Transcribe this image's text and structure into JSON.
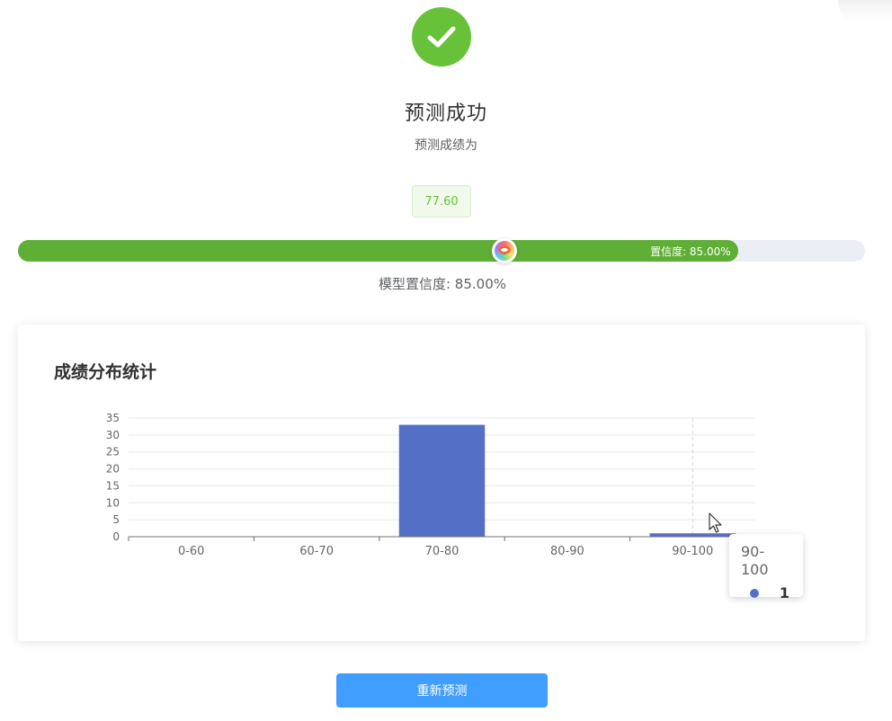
{
  "result": {
    "title": "预测成功",
    "subtitle": "预测成绩为",
    "score": "77.60",
    "success_color": "#67c23a",
    "icon": "check-icon"
  },
  "confidence": {
    "progress_text": "置信度: 85.00%",
    "label": "模型置信度: 85.00%",
    "percent": 85,
    "fill_color": "#5fae35",
    "track_color": "#ebeef5"
  },
  "distribution": {
    "title": "成绩分布统计",
    "chart_data": {
      "type": "bar",
      "categories": [
        "0-60",
        "60-70",
        "70-80",
        "80-90",
        "90-100"
      ],
      "values": [
        0,
        0,
        33,
        0,
        1
      ],
      "ylim": [
        0,
        35
      ],
      "yticks": [
        0,
        5,
        10,
        15,
        20,
        25,
        30,
        35
      ],
      "grid": true,
      "bar_color": "#5470c6"
    },
    "tooltip": {
      "category": "90-100",
      "value": "1"
    }
  },
  "actions": {
    "retry_label": "重新预测"
  }
}
